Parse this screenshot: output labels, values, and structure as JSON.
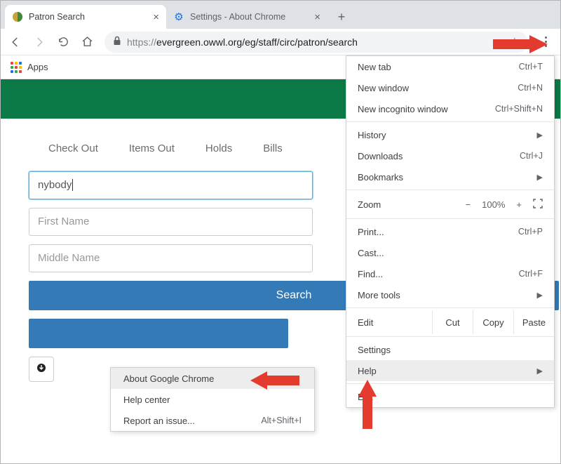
{
  "window": {
    "tabs": [
      {
        "title": "Patron Search",
        "active": true
      },
      {
        "title": "Settings - About Chrome",
        "active": false
      }
    ]
  },
  "toolbar": {
    "url_scheme": "https://",
    "url_rest": "evergreen.owwl.org/eg/staff/circ/patron/search"
  },
  "bookmarks_bar": {
    "apps_label": "Apps"
  },
  "page": {
    "nav_tabs": [
      "Check Out",
      "Items Out",
      "Holds",
      "Bills"
    ],
    "last_name_value": "nybody",
    "first_name_placeholder": "First Name",
    "middle_name_placeholder": "Middle Name",
    "search_button": "Search"
  },
  "chrome_menu": {
    "items_top": [
      {
        "label": "New tab",
        "accel": "Ctrl+T"
      },
      {
        "label": "New window",
        "accel": "Ctrl+N"
      },
      {
        "label": "New incognito window",
        "accel": "Ctrl+Shift+N"
      }
    ],
    "items_history": [
      {
        "label": "History",
        "submenu": true
      },
      {
        "label": "Downloads",
        "accel": "Ctrl+J"
      },
      {
        "label": "Bookmarks",
        "submenu": true
      }
    ],
    "zoom": {
      "label": "Zoom",
      "value": "100%"
    },
    "items_tools": [
      {
        "label": "Print...",
        "accel": "Ctrl+P"
      },
      {
        "label": "Cast..."
      },
      {
        "label": "Find...",
        "accel": "Ctrl+F"
      },
      {
        "label": "More tools",
        "submenu": true
      }
    ],
    "edit": {
      "label": "Edit",
      "cut": "Cut",
      "copy": "Copy",
      "paste": "Paste"
    },
    "items_bottom": [
      {
        "label": "Settings"
      },
      {
        "label": "Help",
        "submenu": true,
        "hover": true
      },
      {
        "label": "Exit"
      }
    ]
  },
  "help_submenu": {
    "items": [
      {
        "label": "About Google Chrome",
        "hover": true
      },
      {
        "label": "Help center"
      },
      {
        "label": "Report an issue...",
        "accel": "Alt+Shift+I"
      }
    ]
  }
}
